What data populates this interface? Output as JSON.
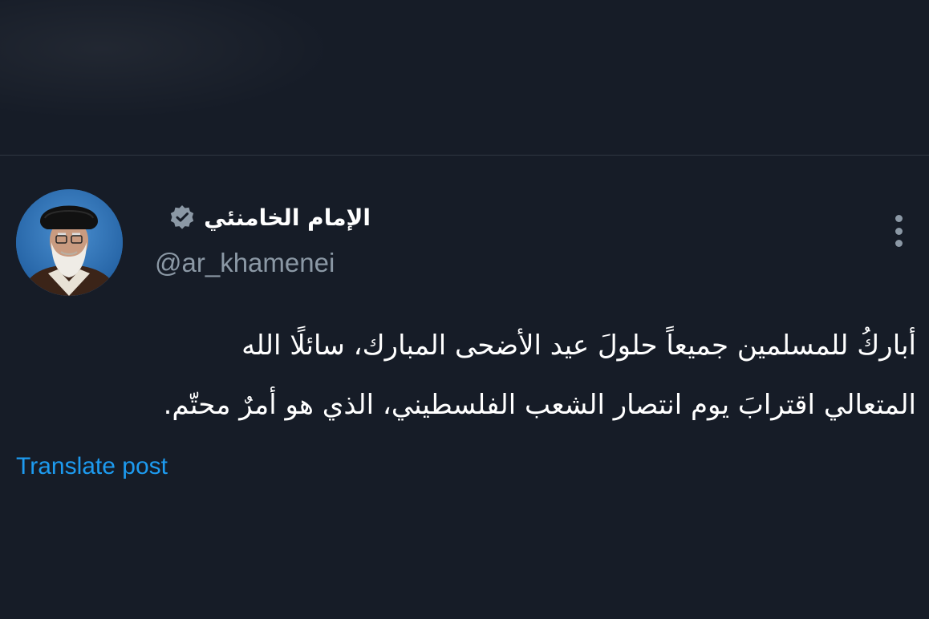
{
  "post": {
    "author": {
      "display_name": "الإمام الخامنئي",
      "handle": "@ar_khamenei",
      "verified": true,
      "verified_badge_color": "#8b98a5"
    },
    "text_lines": [
      "أباركُ للمسلمين جميعاً حلولَ عيد الأضحى المبارك، سائلًا الله",
      "المتعالي اقترابَ يوم انتصار الشعب الفلسطيني، الذي هو أمرٌ محتّم."
    ],
    "translate_label": "Translate post",
    "more_icon": "more-vertical-icon"
  },
  "colors": {
    "background": "#161c27",
    "primary_text": "#ffffff",
    "secondary_text": "#8b98a5",
    "link": "#1d9bf0",
    "divider": "#2f3742"
  }
}
